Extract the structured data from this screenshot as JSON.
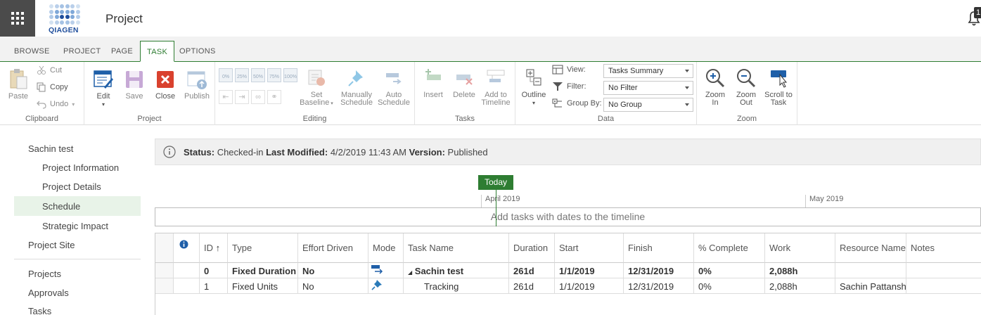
{
  "app": {
    "logo_text": "QIAGEN",
    "title": "Project",
    "notification_count": "1"
  },
  "tabs": [
    "BROWSE",
    "PROJECT",
    "PAGE",
    "TASK",
    "OPTIONS"
  ],
  "ribbon": {
    "clipboard": {
      "paste": "Paste",
      "cut": "Cut",
      "copy": "Copy",
      "undo": "Undo",
      "label": "Clipboard"
    },
    "project": {
      "edit": "Edit",
      "save": "Save",
      "close": "Close",
      "publish": "Publish",
      "label": "Project"
    },
    "editing": {
      "set_baseline_1": "Set",
      "set_baseline_2": "Baseline",
      "manually_1": "Manually",
      "manually_2": "Schedule",
      "auto_1": "Auto",
      "auto_2": "Schedule",
      "label": "Editing",
      "pct": [
        "0%",
        "25%",
        "50%",
        "75%",
        "100%"
      ]
    },
    "tasks": {
      "insert": "Insert",
      "delete": "Delete",
      "add_timeline_1": "Add to",
      "add_timeline_2": "Timeline",
      "label": "Tasks"
    },
    "data": {
      "outline": "Outline",
      "view_label": "View:",
      "view_value": "Tasks Summary",
      "filter_label": "Filter:",
      "filter_value": "No Filter",
      "group_label": "Group By:",
      "group_value": "No Group",
      "label": "Data"
    },
    "zoom": {
      "zoom_in_1": "Zoom",
      "zoom_in_2": "In",
      "zoom_out_1": "Zoom",
      "zoom_out_2": "Out",
      "scroll_1": "Scroll to",
      "scroll_2": "Task",
      "label": "Zoom"
    }
  },
  "nav": {
    "items": [
      "Sachin test",
      "Project Information",
      "Project Details",
      "Schedule",
      "Strategic Impact",
      "Project Site",
      "Projects",
      "Approvals",
      "Tasks"
    ]
  },
  "status": {
    "status_label": "Status:",
    "status_value": "Checked-in",
    "modified_label": "Last Modified:",
    "modified_value": "4/2/2019 11:43 AM",
    "version_label": "Version:",
    "version_value": "Published"
  },
  "timeline": {
    "today": "Today",
    "month1": "April 2019",
    "month2": "May 2019",
    "placeholder": "Add tasks with dates to the timeline"
  },
  "table": {
    "headers": [
      "ID",
      "Type",
      "Effort Driven",
      "Mode",
      "Task Name",
      "Duration",
      "Start",
      "Finish",
      "% Complete",
      "Work",
      "Resource Name",
      "Notes"
    ],
    "sort_arrow": "↑",
    "rows": [
      {
        "id": "0",
        "type": "Fixed Duration",
        "effort": "No",
        "task": "Sachin test",
        "duration": "261d",
        "start": "1/1/2019",
        "finish": "12/31/2019",
        "complete": "0%",
        "work": "2,088h",
        "resource": "",
        "notes": ""
      },
      {
        "id": "1",
        "type": "Fixed Units",
        "effort": "No",
        "task": "Tracking",
        "duration": "261d",
        "start": "1/1/2019",
        "finish": "12/31/2019",
        "complete": "0%",
        "work": "2,088h",
        "resource": "Sachin Pattanshetti",
        "notes": ""
      }
    ]
  },
  "colors": {
    "accent": "#2e7d32",
    "brand": "#1f4e9c"
  }
}
